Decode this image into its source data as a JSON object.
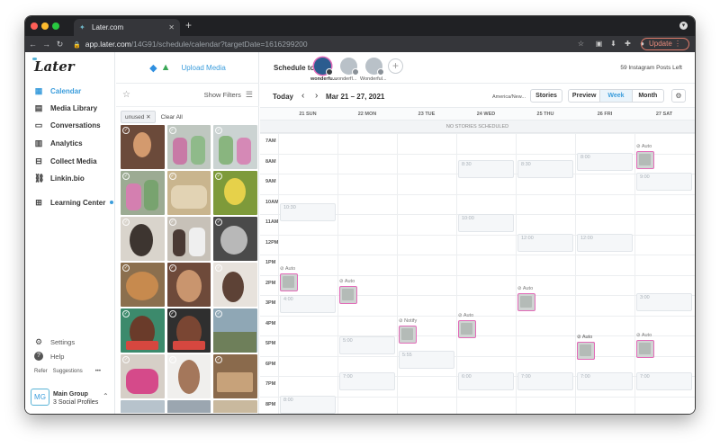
{
  "browser": {
    "tab_title": "Later.com",
    "new_tab": "+",
    "url_host": "app.later.com",
    "url_path": "/14G91/schedule/calendar?targetDate=1616299200",
    "update_label": "Update"
  },
  "nav": {
    "logo": "Later",
    "items": [
      {
        "label": "Calendar",
        "icon": "calendar-icon"
      },
      {
        "label": "Media Library",
        "icon": "media-library-icon"
      },
      {
        "label": "Conversations",
        "icon": "conversations-icon"
      },
      {
        "label": "Analytics",
        "icon": "analytics-icon"
      },
      {
        "label": "Collect Media",
        "icon": "collect-media-icon"
      },
      {
        "label": "Linkin.bio",
        "icon": "linkinbio-icon"
      },
      {
        "label": "Learning Center",
        "icon": "learning-center-icon"
      }
    ],
    "settings": "Settings",
    "help": "Help",
    "refer": "Refer",
    "suggestions": "Suggestions",
    "more": "•••",
    "group_initials": "MG",
    "group_name": "Main Group",
    "group_profiles": "3 Social Profiles"
  },
  "media": {
    "upload_label": "Upload Media",
    "show_filters": "Show Filters",
    "chip": "unused",
    "clear_all": "Clear All"
  },
  "schedule": {
    "schedule_to": "Schedule to",
    "profiles": [
      {
        "label": "wonderfu..."
      },
      {
        "label": "wonderfl..."
      },
      {
        "label": "Wonderful..."
      }
    ],
    "posts_left": "59 Instagram Posts Left"
  },
  "toolbar": {
    "today": "Today",
    "date_range": "Mar 21 – 27, 2021",
    "timezone": "America/New...",
    "stories": "Stories",
    "preview": "Preview",
    "week": "Week",
    "month": "Month"
  },
  "days": [
    "21 SUN",
    "22 MON",
    "23 TUE",
    "24 WED",
    "25 THU",
    "26 FRI",
    "27 SAT"
  ],
  "no_stories": "NO STORIES SCHEDULED",
  "hours": [
    "7AM",
    "8AM",
    "9AM",
    "10AM",
    "11AM",
    "12PM",
    "1PM",
    "2PM",
    "3PM",
    "4PM",
    "5PM",
    "6PM",
    "7PM",
    "8PM"
  ],
  "slots": [
    {
      "day": 0,
      "time": "10:30"
    },
    {
      "day": 0,
      "time": "4:00"
    },
    {
      "day": 0,
      "time": "8:00"
    },
    {
      "day": 1,
      "time": "5:00"
    },
    {
      "day": 1,
      "time": "7:00"
    },
    {
      "day": 2,
      "time": "5:55"
    },
    {
      "day": 3,
      "time": "8:30"
    },
    {
      "day": 3,
      "time": "10:00"
    },
    {
      "day": 3,
      "time": "6:00"
    },
    {
      "day": 4,
      "time": "8:30"
    },
    {
      "day": 4,
      "time": "12:00"
    },
    {
      "day": 4,
      "time": "7:00"
    },
    {
      "day": 5,
      "time": "8:00"
    },
    {
      "day": 5,
      "time": "12:00"
    },
    {
      "day": 5,
      "time": "7:00"
    },
    {
      "day": 6,
      "time": "9:00"
    },
    {
      "day": 6,
      "time": "3:00"
    },
    {
      "day": 6,
      "time": "7:00"
    }
  ],
  "posts": [
    {
      "day": 0,
      "tag": "Auto"
    },
    {
      "day": 1,
      "tag": "Auto"
    },
    {
      "day": 2,
      "tag": "Notify"
    },
    {
      "day": 3,
      "tag": "Auto"
    },
    {
      "day": 4,
      "tag": "Auto"
    },
    {
      "day": 5,
      "tag": "Auto"
    },
    {
      "day": 5,
      "tag": "Auto"
    },
    {
      "day": 6,
      "tag": "Auto"
    },
    {
      "day": 6,
      "tag": "Auto"
    }
  ]
}
